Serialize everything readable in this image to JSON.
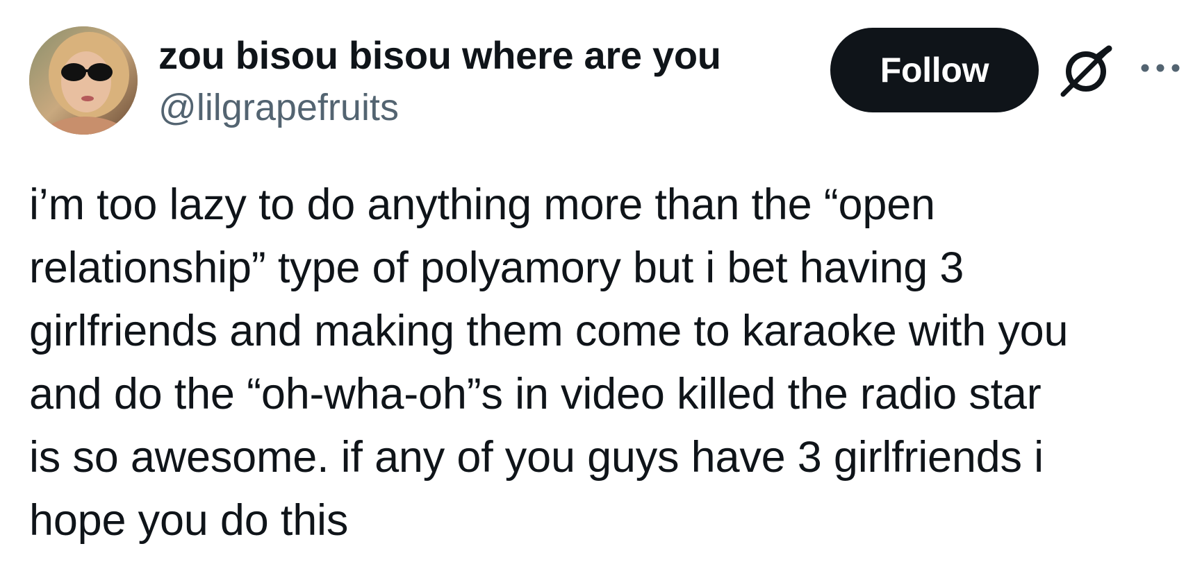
{
  "author": {
    "display_name": "zou bisou bisou where are you",
    "handle": "@lilgrapefruits"
  },
  "actions": {
    "follow_label": "Follow",
    "grok_icon": "grok-icon",
    "more_icon": "more-icon"
  },
  "tweet": {
    "text": "i’m too lazy to do anything more than the “open\nrelationship” type of polyamory but i bet having 3\ngirlfriends and making them come to karaoke with you\nand do the “oh-wha-oh”s in video killed the radio star\nis so awesome. if any of you guys have 3 girlfriends i\nhope you do this"
  },
  "colors": {
    "text_primary": "#0f1419",
    "text_secondary": "#536471",
    "button_bg": "#0f1419",
    "button_text": "#ffffff"
  }
}
